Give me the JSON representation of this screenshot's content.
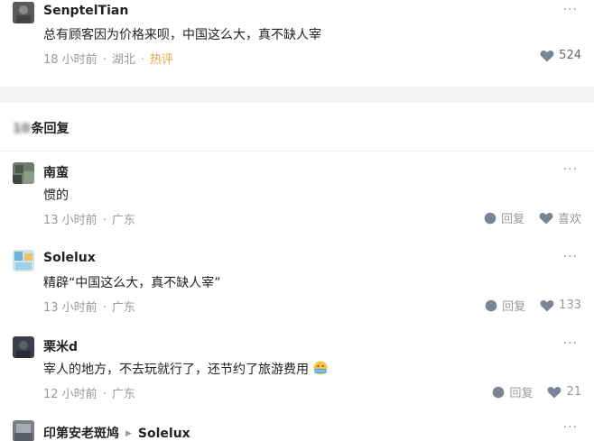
{
  "main_comment": {
    "username": "SenptelTian",
    "text": "总有顾客因为价格来呗，中国这么大，真不缺人宰",
    "time": "18 小时前",
    "location": "湖北",
    "tag": "热评",
    "likes": "524",
    "more": "···"
  },
  "replies_header": {
    "count": "10",
    "label": "条回复"
  },
  "replies": [
    {
      "username": "南蛮",
      "text": "惯的",
      "time": "13 小时前",
      "location": "广东",
      "reply_label": "回复",
      "like_label": "喜欢",
      "more": "···"
    },
    {
      "username": "Solelux",
      "text": "精辟“中国这么大，真不缺人宰”",
      "time": "13 小时前",
      "location": "广东",
      "reply_label": "回复",
      "like_label": "133",
      "more": "···"
    },
    {
      "username": "栗米d",
      "text": "宰人的地方，不去玩就行了，还节约了旅游费用",
      "time": "12 小时前",
      "location": "广东",
      "reply_label": "回复",
      "like_label": "21",
      "more": "···"
    },
    {
      "username": "印第安老斑鸠",
      "reply_to": "Solelux",
      "more": "···"
    }
  ],
  "colors": {
    "meta_text": "#999999",
    "hot_tag": "#e6a23c",
    "separator": "#f3f4f6"
  }
}
